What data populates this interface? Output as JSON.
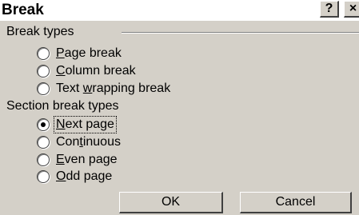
{
  "window": {
    "title": "Break",
    "help_glyph": "?",
    "close_glyph": "×"
  },
  "break_types": {
    "label": "Break types",
    "options": [
      {
        "pre": "",
        "mn": "P",
        "post": "age break",
        "checked": false
      },
      {
        "pre": "",
        "mn": "C",
        "post": "olumn break",
        "checked": false
      },
      {
        "pre": "Text ",
        "mn": "w",
        "post": "rapping break",
        "checked": false
      }
    ]
  },
  "section_break_types": {
    "label": "Section break types",
    "options": [
      {
        "pre": "",
        "mn": "N",
        "post": "ext page",
        "checked": true
      },
      {
        "pre": "Con",
        "mn": "t",
        "post": "inuous",
        "checked": false
      },
      {
        "pre": "",
        "mn": "E",
        "post": "ven page",
        "checked": false
      },
      {
        "pre": "",
        "mn": "O",
        "post": "dd page",
        "checked": false
      }
    ]
  },
  "buttons": {
    "ok": "OK",
    "cancel": "Cancel"
  },
  "colors": {
    "dialog_face": "#d4d0c8",
    "shadow": "#404040",
    "highlight": "#ffffff"
  }
}
